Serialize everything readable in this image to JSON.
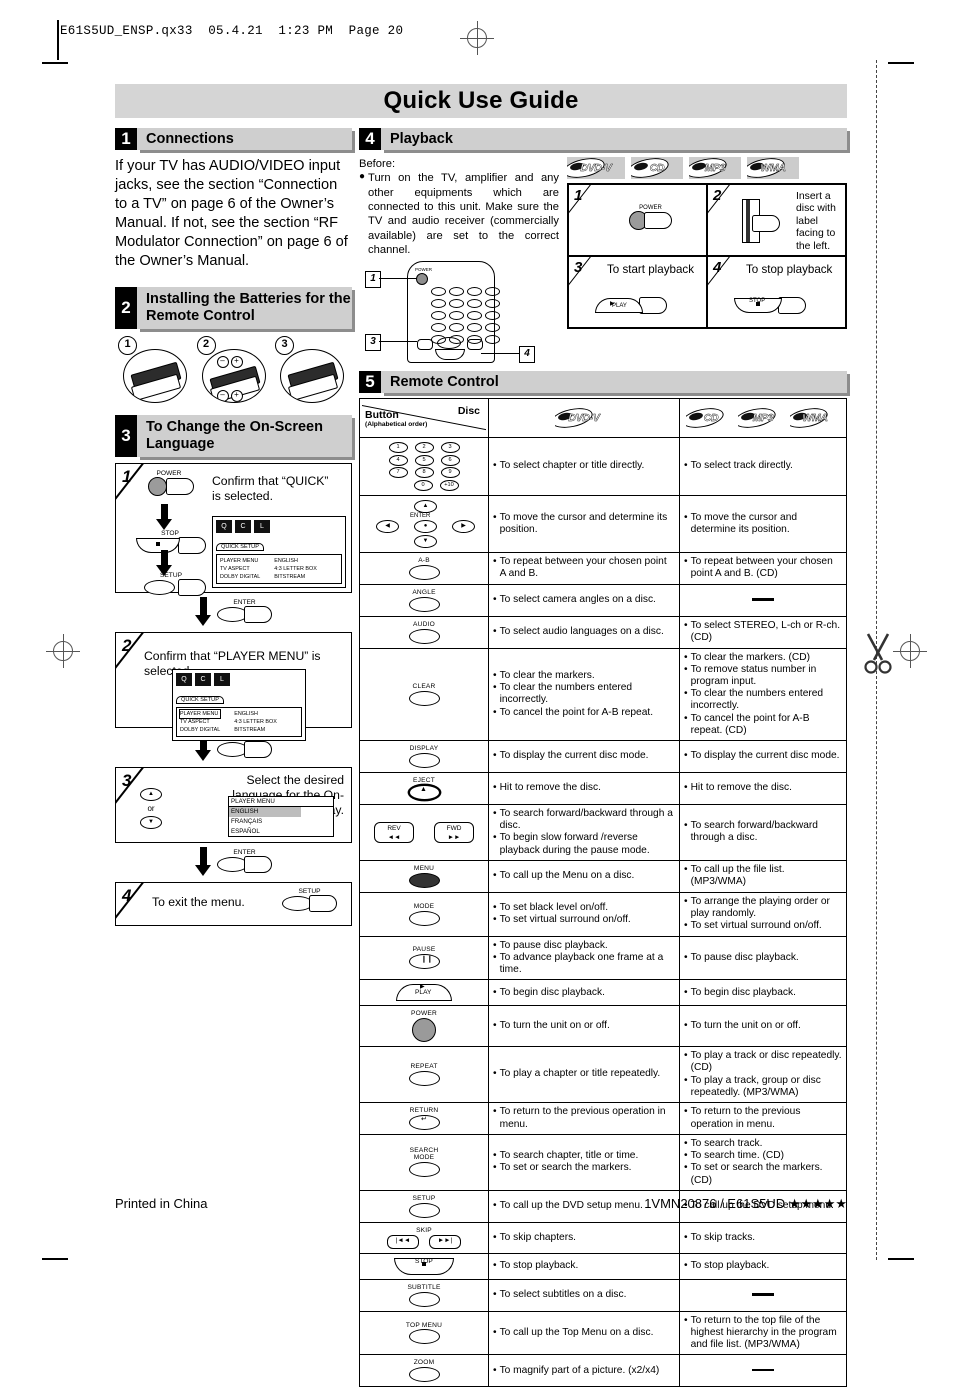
{
  "print_header": "E61S5UD_ENSP.qx33  05.4.21  1:23 PM  Page 20",
  "page_title": "Quick Use Guide",
  "footer": {
    "left": "Printed in China",
    "right": "1VMN20876 / E61S5UD ★★★★★"
  },
  "sections": {
    "connections": {
      "number": "1",
      "title": "Connections",
      "body": "If your TV has AUDIO/VIDEO input jacks, see the section “Connection to a TV” on page 6 of the Owner’s Manual. If not, see the section “RF Modulator Connection” on page 6 of the Owner’s Manual."
    },
    "batteries": {
      "number": "2",
      "title": "Installing the Batteries for the Remote Control",
      "steps": [
        "1",
        "2",
        "3"
      ],
      "polarity": [
        "–",
        "+",
        "–",
        "+"
      ]
    },
    "language": {
      "number": "3",
      "title": "To Change the On-Screen Language",
      "steps": [
        {
          "num": "1",
          "text": "Confirm that “QUICK” is selected.",
          "buttons": [
            "POWER",
            "STOP",
            "SETUP"
          ],
          "osd": {
            "tab": "QUICK SETUP",
            "icons": [
              "Q",
              "C",
              "L"
            ],
            "rows_left": [
              "PLAYER MENU",
              "TV ASPECT",
              "DOLBY DIGITAL"
            ],
            "rows_right": [
              "ENGLISH",
              "4:3 LETTER BOX",
              "BITSTREAM"
            ]
          }
        },
        {
          "num": "2",
          "text": "Confirm that “PLAYER MENU” is selected.",
          "osd": {
            "tab": "QUICK SETUP",
            "icons": [
              "Q",
              "C",
              "L"
            ],
            "rows_left": [
              "PLAYER MENU",
              "TV ASPECT",
              "DOLBY DIGITAL"
            ],
            "rows_right": [
              "ENGLISH",
              "4:3 LETTER BOX",
              "BITSTREAM"
            ]
          }
        },
        {
          "num": "3",
          "text": "Select the desired language for the On-Screen Display.",
          "or_label": "or",
          "menu_title": "PLAYER MENU",
          "menu_items": [
            "ENGLISH",
            "FRANÇAIS",
            "ESPAÑOL"
          ]
        },
        {
          "num": "4",
          "text": "To exit the menu.",
          "buttons": [
            "SETUP"
          ]
        }
      ],
      "enter_label": "ENTER"
    },
    "playback": {
      "number": "4",
      "title": "Playback",
      "before_label": "Before:",
      "before_text": "Turn on the TV, amplifier and any other equipments which are connected to this unit. Make sure the TV and audio receiver (commercially available) are set to the correct channel.",
      "remote_callouts": [
        "1",
        "3",
        "4"
      ],
      "remote_power_label": "POWER",
      "logos": [
        "DVD-V",
        "CD",
        "MP3",
        "WMA"
      ],
      "cells": [
        {
          "num": "1",
          "text": "",
          "button": "POWER"
        },
        {
          "num": "2",
          "text": "Insert a disc with label facing to the left."
        },
        {
          "num": "3",
          "text": "To start playback",
          "button": "PLAY"
        },
        {
          "num": "4",
          "text": "To stop playback",
          "button": "STOP"
        }
      ]
    },
    "remote_control": {
      "number": "5",
      "title": "Remote Control",
      "table_header": {
        "button": "Button",
        "button_sub": "(Alphabetical order)",
        "disc": "Disc",
        "dvd_logo": "DVD-V",
        "cd_logos": [
          "CD",
          "MP3",
          "WMA"
        ]
      },
      "rows": [
        {
          "button": "NUMBER",
          "label": "",
          "dvd": [
            "To select chapter or title directly."
          ],
          "cd": [
            "To select track directly."
          ]
        },
        {
          "button": "CURSOR/ENTER",
          "label": "ENTER",
          "dvd": [
            "To move the cursor and determine its position."
          ],
          "cd": [
            "To move the cursor and determine its position."
          ]
        },
        {
          "button": "A-B",
          "label": "A-B",
          "dvd": [
            "To repeat between your chosen point A and B."
          ],
          "cd": [
            "To repeat between your chosen point A and B. (CD)"
          ]
        },
        {
          "button": "ANGLE",
          "label": "ANGLE",
          "dvd": [
            "To select camera angles on a disc."
          ],
          "cd": []
        },
        {
          "button": "AUDIO",
          "label": "AUDIO",
          "dvd": [
            "To select audio languages on a disc."
          ],
          "cd": [
            "To select STEREO, L-ch or R-ch. (CD)"
          ]
        },
        {
          "button": "CLEAR",
          "label": "CLEAR",
          "dvd": [
            "To clear the markers.",
            "To clear the numbers entered incorrectly.",
            "To cancel the point for A-B repeat."
          ],
          "cd": [
            "To clear the markers. (CD)",
            "To remove status number in program input.",
            "To clear the numbers entered incorrectly.",
            "To cancel the point for A-B repeat. (CD)"
          ]
        },
        {
          "button": "DISPLAY",
          "label": "DISPLAY",
          "dvd": [
            "To display the current disc mode."
          ],
          "cd": [
            "To display the current disc mode."
          ]
        },
        {
          "button": "EJECT",
          "label": "EJECT",
          "dvd": [
            "Hit to remove the disc."
          ],
          "cd": [
            "Hit to remove the disc."
          ]
        },
        {
          "button": "REV/FWD",
          "label": "REV ◄◄ / FWD ►►",
          "dvd": [
            "To search forward/backward through a disc.",
            "To begin slow forward /reverse playback during the pause mode."
          ],
          "cd": [
            "To search forward/backward through a disc."
          ]
        },
        {
          "button": "MENU",
          "label": "MENU",
          "dvd": [
            "To call up the Menu on a disc."
          ],
          "cd": [
            "To call up the file list. (MP3/WMA)"
          ]
        },
        {
          "button": "MODE",
          "label": "MODE",
          "dvd": [
            "To set black level on/off.",
            "To set virtual surround on/off."
          ],
          "cd": [
            "To arrange the playing order or play randomly.",
            "To set virtual surround on/off."
          ]
        },
        {
          "button": "PAUSE",
          "label": "PAUSE",
          "dvd": [
            "To pause disc playback.",
            "To advance playback one frame at a time."
          ],
          "cd": [
            "To pause disc playback."
          ]
        },
        {
          "button": "PLAY",
          "label": "PLAY",
          "dvd": [
            "To begin disc playback."
          ],
          "cd": [
            "To begin disc playback."
          ]
        },
        {
          "button": "POWER",
          "label": "POWER",
          "dvd": [
            "To turn the unit on or off."
          ],
          "cd": [
            "To turn the unit on or off."
          ]
        },
        {
          "button": "REPEAT",
          "label": "REPEAT",
          "dvd": [
            "To play a chapter or title repeatedly."
          ],
          "cd": [
            "To play a track or disc repeatedly. (CD)",
            "To play a track, group or disc repeatedly. (MP3/WMA)"
          ]
        },
        {
          "button": "RETURN",
          "label": "RETURN",
          "dvd": [
            "To return to the previous operation in menu."
          ],
          "cd": [
            "To return to the previous operation in menu."
          ]
        },
        {
          "button": "SEARCH MODE",
          "label": "SEARCH MODE",
          "dvd": [
            "To search chapter, title or time.",
            "To set or search the markers."
          ],
          "cd": [
            "To search track.",
            "To search time. (CD)",
            "To set or search the markers. (CD)"
          ]
        },
        {
          "button": "SETUP",
          "label": "SETUP",
          "dvd": [
            "To call up the DVD setup menu."
          ],
          "cd": [
            "To call up the DVD setup menu."
          ]
        },
        {
          "button": "SKIP",
          "label": "SKIP",
          "dvd": [
            "To skip chapters."
          ],
          "cd": [
            "To skip tracks."
          ]
        },
        {
          "button": "STOP",
          "label": "STOP",
          "dvd": [
            "To stop playback."
          ],
          "cd": [
            "To stop playback."
          ]
        },
        {
          "button": "SUBTITLE",
          "label": "SUBTITLE",
          "dvd": [
            "To select subtitles on a disc."
          ],
          "cd": []
        },
        {
          "button": "TOP MENU",
          "label": "TOP MENU",
          "dvd": [
            "To call up the Top Menu on a disc."
          ],
          "cd": [
            "To return to the top file of the highest hierarchy in the program and file list. (MP3/WMA)"
          ]
        },
        {
          "button": "ZOOM",
          "label": "ZOOM",
          "dvd": [
            "To magnify part of a picture. (x2/x4)"
          ],
          "cd": []
        }
      ]
    }
  },
  "colors": {
    "band": "#d5d5d5",
    "section_bar": "#cfcfcf",
    "section_shadow": "#8d8d8d",
    "logo_bg": "#cccccc",
    "button_grey": "#9b9b9b"
  }
}
